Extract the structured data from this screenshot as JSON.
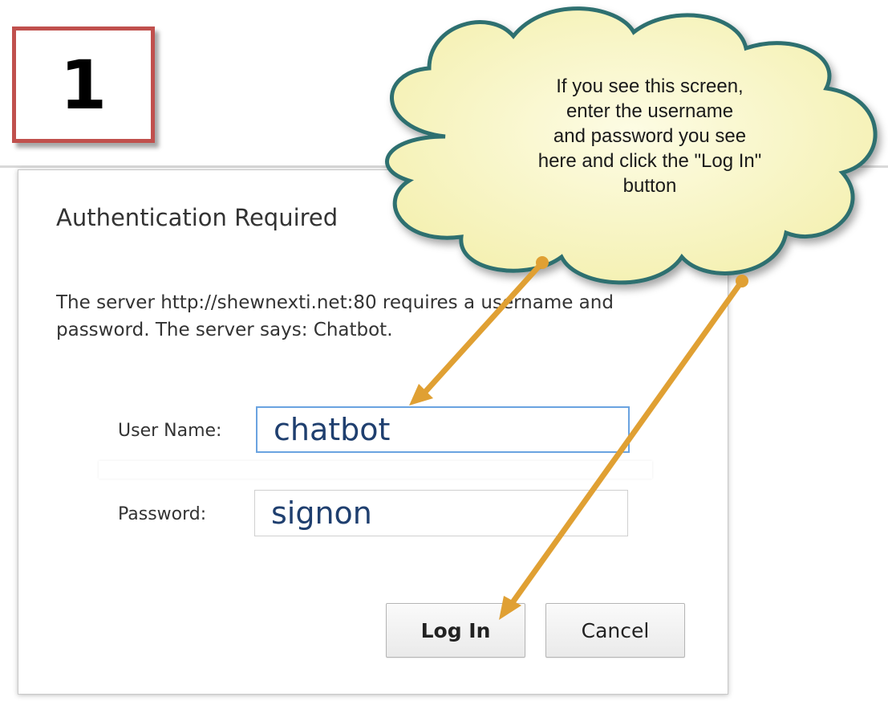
{
  "step": {
    "number": "1"
  },
  "dialog": {
    "title": "Authentication Required",
    "message": "The server http://shewnexti.net:80 requires a username and password. The server says: Chatbot.",
    "fields": {
      "username": {
        "label": "User Name:",
        "value": "chatbot"
      },
      "password": {
        "label": "Password:",
        "value": "signon"
      }
    },
    "buttons": {
      "login_label": "Log In",
      "cancel_label": "Cancel"
    }
  },
  "callout": {
    "text": "If you see this screen, enter the username and password you see here and click the \"Log In\" button",
    "lines": [
      "If you see this screen,",
      "enter the username",
      "and password you see",
      "here and click the \"Log In\"",
      "button"
    ]
  },
  "colors": {
    "step_border": "#c0504d",
    "cloud_fill": "#fbf8c8",
    "cloud_outline": "#2f6f6f",
    "arrow": "#e0a033",
    "focus_border": "#6aa3e0",
    "input_text": "#1f3f6f"
  }
}
